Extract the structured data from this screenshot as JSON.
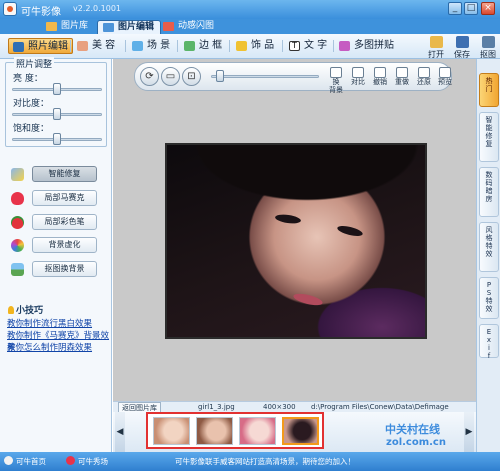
{
  "window": {
    "title": "可牛影像",
    "version": "v2.2.0.1001",
    "controls": [
      "_",
      "□",
      "×"
    ]
  },
  "tabs": [
    {
      "label": "图片库",
      "icon": "gallery-icon",
      "active": false
    },
    {
      "label": "图片编辑",
      "icon": "edit-image-icon",
      "active": true
    },
    {
      "label": "动感闪图",
      "icon": "flash-image-icon",
      "active": false
    }
  ],
  "toolbar": {
    "tools": [
      {
        "label": "照片编辑",
        "icon": "photo-edit-icon",
        "active": true
      },
      {
        "label": "美 容",
        "icon": "beauty-icon",
        "active": false
      },
      {
        "label": "场 景",
        "icon": "scene-icon",
        "active": false
      },
      {
        "label": "边 框",
        "icon": "frame-icon",
        "active": false
      },
      {
        "label": "饰 品",
        "icon": "accessory-icon",
        "active": false
      },
      {
        "label": "文 字",
        "icon": "text-icon",
        "active": false
      },
      {
        "label": "多图拼贴",
        "icon": "collage-icon",
        "active": false
      }
    ],
    "right": [
      {
        "label": "打开",
        "icon": "open-icon"
      },
      {
        "label": "保存",
        "icon": "save-icon"
      },
      {
        "label": "抠图",
        "icon": "cutout-icon"
      }
    ]
  },
  "adjust": {
    "legend": "照片调整",
    "sliders": [
      {
        "label": "亮 度：",
        "value": 0.5
      },
      {
        "label": "对比度：",
        "value": 0.5
      },
      {
        "label": "饱和度：",
        "value": 0.5
      }
    ]
  },
  "functions": [
    {
      "label": "智能修复",
      "icon": "magic-wand-icon",
      "active": true
    },
    {
      "label": "局部马赛克",
      "icon": "heart-icon",
      "active": false
    },
    {
      "label": "局部彩色笔",
      "icon": "strawberry-icon",
      "active": false
    },
    {
      "label": "背景虚化",
      "icon": "color-dots-icon",
      "active": false
    },
    {
      "label": "抠图换背景",
      "icon": "landscape-icon",
      "active": false
    }
  ],
  "tips": {
    "title": "小技巧",
    "links": [
      "教你制作流行黑白效果",
      "教你制作《马赛克》背景效果",
      "教你怎么制作阴森效果"
    ]
  },
  "canvas_controls": {
    "round_buttons": [
      {
        "icon": "rotate-icon",
        "glyph": "⟳"
      },
      {
        "icon": "monitor-icon",
        "glyph": "▭"
      },
      {
        "icon": "fit-icon",
        "glyph": "⊡"
      }
    ],
    "zoom_value": 0.05,
    "actions": [
      {
        "label": "换\n背景",
        "icon": "change-bg-icon"
      },
      {
        "label": "对比",
        "icon": "compare-icon"
      },
      {
        "label": "撤销",
        "icon": "undo-icon"
      },
      {
        "label": "重做",
        "icon": "redo-icon"
      },
      {
        "label": "还原",
        "icon": "restore-icon"
      },
      {
        "label": "预览",
        "icon": "preview-icon"
      }
    ]
  },
  "thumb_info": {
    "back_label": "返回图片库",
    "filename": "girl1_3.jpg",
    "dimensions": "400×300",
    "path": "d:\\Program Files\\Conew\\Data\\Defimage"
  },
  "thumbnails": [
    {
      "name": "baby-thumbnail",
      "colors": [
        "#f2d4c2",
        "#c98f73"
      ],
      "selected": false
    },
    {
      "name": "toddler-thumbnail",
      "colors": [
        "#e9c2ad",
        "#8e5a44"
      ],
      "selected": false
    },
    {
      "name": "girl-pink-thumbnail",
      "colors": [
        "#f6d9d4",
        "#d76c87"
      ],
      "selected": false
    },
    {
      "name": "girl-dark-thumbnail",
      "colors": [
        "#2a1a20",
        "#c9988c"
      ],
      "selected": true
    }
  ],
  "right_tabs": [
    "热 门",
    "智能修复",
    "数码暗房",
    "风格特效",
    "PS特效",
    "Exif"
  ],
  "status": {
    "home": "可牛首页",
    "showcase": "可牛秀场",
    "message": "可牛影像联手威客网站打造高清场景，期待您的加入！",
    "watermark1": "中关村在线",
    "watermark2": "zol.com.cn"
  },
  "colors": {
    "accent": "#3a8fdc",
    "active_tool": "#f0a93a",
    "thumb_frame": "#e23131"
  }
}
